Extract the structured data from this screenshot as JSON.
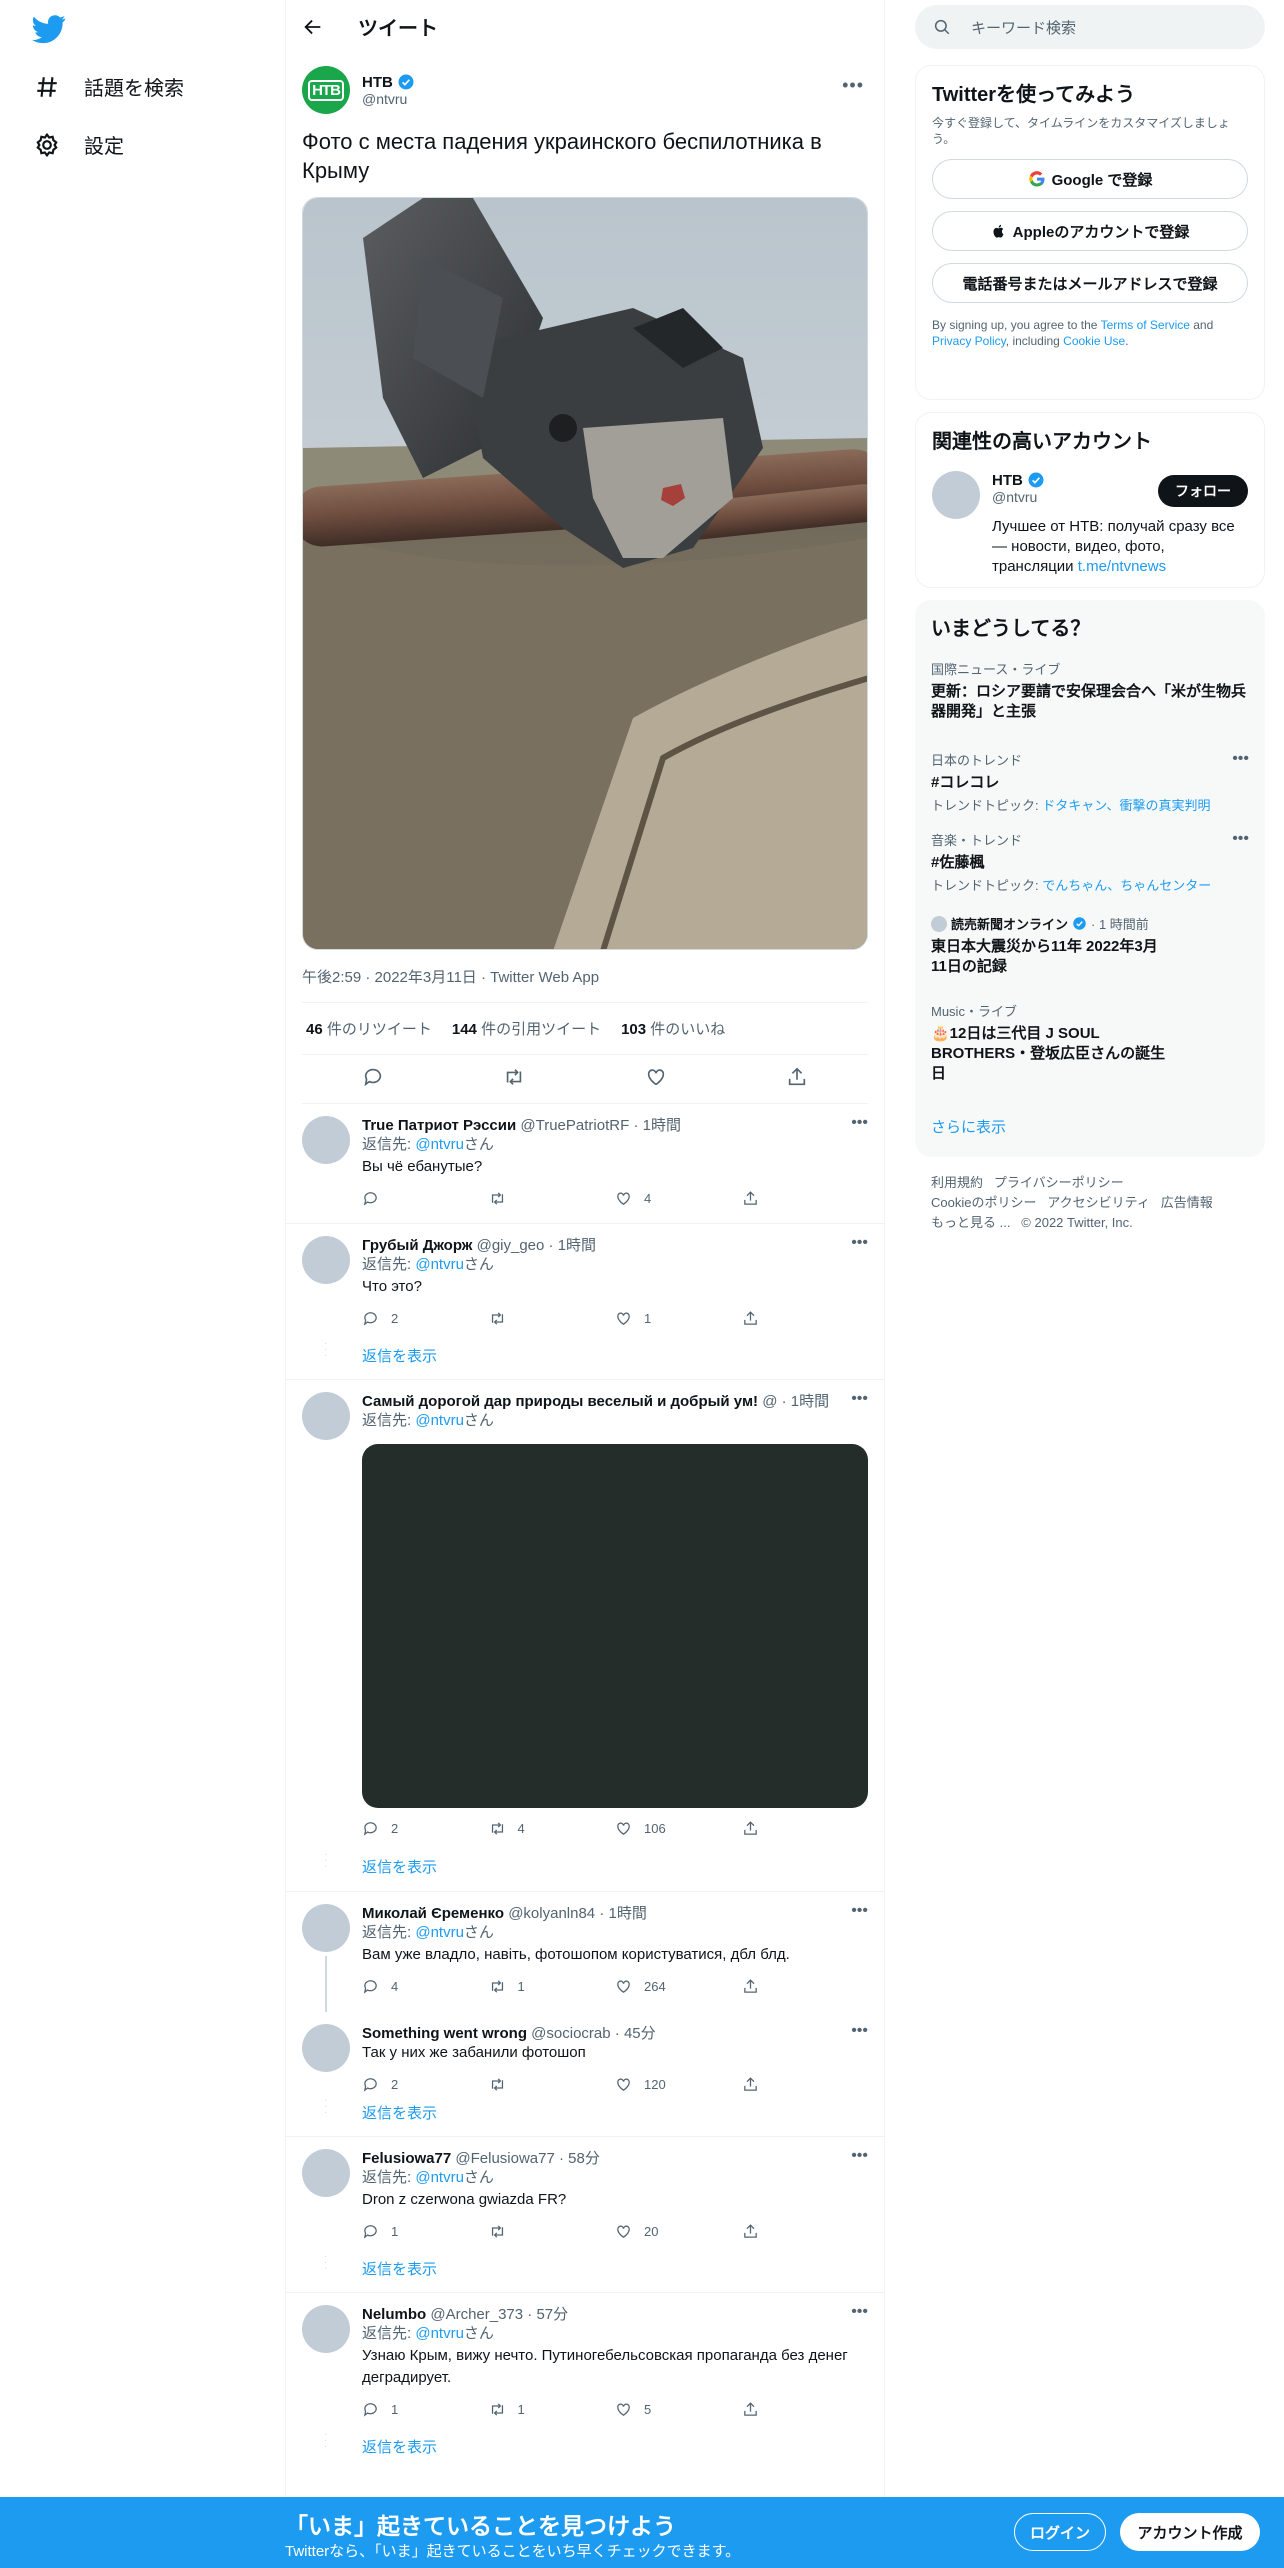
{
  "nav": {
    "explore_label": "話題を検索",
    "settings_label": "設定"
  },
  "header": {
    "title": "ツイート"
  },
  "main_tweet": {
    "name": "НТВ",
    "handle": "@ntvru",
    "avatar_text": "НТВ",
    "text": "Фото с места падения украинского беспилотника в Крыму",
    "meta": "午後2:59 · 2022年3月11日 · Twitter Web App",
    "retweets_count": "46",
    "retweets_label": "件のリツイート",
    "quotes_count": "144",
    "quotes_label": "件の引用ツイート",
    "likes_count": "103",
    "likes_label": "件のいいね"
  },
  "replies": [
    {
      "name": "True Патриот Рэссии",
      "handle": "@TruePatriotRF",
      "time": "· 1時間",
      "reply_to_prefix": "返信先: ",
      "reply_to": "@ntvru",
      "reply_to_suffix": "さん",
      "text": "Вы чё ебанутые?",
      "replies": "",
      "retweets": "",
      "likes": "4"
    },
    {
      "name": "Грубый Джорж",
      "handle": "@giy_geo",
      "time": "· 1時間",
      "reply_to_prefix": "返信先: ",
      "reply_to": "@ntvru",
      "reply_to_suffix": "さん",
      "text": "Что это?",
      "replies": "2",
      "retweets": "",
      "likes": "1",
      "show_replies": "返信を表示"
    },
    {
      "name": "Самый дорогой дар природы веселый и добрый ум!",
      "handle": "@",
      "time": "· 1時間",
      "reply_to_prefix": "返信先: ",
      "reply_to": "@ntvru",
      "reply_to_suffix": "さん",
      "text": "",
      "replies": "2",
      "retweets": "4",
      "likes": "106",
      "show_replies": "返信を表示"
    },
    {
      "name": "Миколай Єременко",
      "handle": "@kolyanln84",
      "time": "· 1時間",
      "reply_to_prefix": "返信先: ",
      "reply_to": "@ntvru",
      "reply_to_suffix": "さん",
      "text": "Вам уже владло, навіть, фотошопом користуватися, дбл блд.",
      "replies": "4",
      "retweets": "1",
      "likes": "264"
    },
    {
      "name": "Something went wrong",
      "handle": "@sociocrab",
      "time": "· 45分",
      "text": "Так у них же забанили фотошоп",
      "replies": "2",
      "retweets": "",
      "likes": "120",
      "show_replies": "返信を表示"
    },
    {
      "name": "Felusiowa77",
      "handle": "@Felusiowa77",
      "time": "· 58分",
      "reply_to_prefix": "返信先: ",
      "reply_to": "@ntvru",
      "reply_to_suffix": "さん",
      "text": "Dron z czerwona gwiazda FR?",
      "replies": "1",
      "retweets": "",
      "likes": "20",
      "show_replies": "返信を表示"
    },
    {
      "name": "Nelumbo",
      "handle": "@Archer_373",
      "time": "· 57分",
      "reply_to_prefix": "返信先: ",
      "reply_to": "@ntvru",
      "reply_to_suffix": "さん",
      "text": "Узнаю Крым, вижу нечто. Путиногебельсовская пропаганда без денег деградирует.",
      "replies": "1",
      "retweets": "1",
      "likes": "5",
      "show_replies": "返信を表示"
    }
  ],
  "search": {
    "placeholder": "キーワード検索"
  },
  "signup_card": {
    "title": "Twitterを使ってみよう",
    "subtitle": "今すぐ登録して、タイムラインをカスタマイズしましょう。",
    "google": "Google で登録",
    "apple": "Appleのアカウントで登録",
    "phone": "電話番号またはメールアドレスで登録",
    "legal_1": "By signing up, you agree to the ",
    "terms": "Terms of Service",
    "legal_2": " and ",
    "privacy": "Privacy Policy",
    "legal_3": ", including ",
    "cookie": "Cookie Use",
    "legal_4": "."
  },
  "related": {
    "title": "関連性の高いアカウント",
    "name": "НТВ",
    "handle": "@ntvru",
    "follow": "フォロー",
    "bio": "Лучшее от НТВ: получай сразу все — новости, видео, фото, трансляции ",
    "bio_link": "t.me/ntvnews"
  },
  "trends": {
    "title": "いまどうしてる？",
    "items": [
      {
        "category": "国際ニュース・ライブ",
        "title": "更新：ロシア要請で安保理会合へ「米が生物兵器開発」と主張"
      },
      {
        "category": "日本のトレンド",
        "title": "#コレコレ",
        "topic_prefix": "トレンドトピック: ",
        "topics": "ドタキャン、衝撃の真実判明"
      },
      {
        "category": "音楽・トレンド",
        "title": "#佐藤楓",
        "topic_prefix": "トレンドトピック: ",
        "topics": "でんちゃん、ちゃんセンター"
      },
      {
        "source": "読売新聞オンライン",
        "time": "· 1 時間前",
        "title": "東日本大震災から11年 2022年3月11日の記録"
      },
      {
        "category": "Music・ライブ",
        "title": "🎂12日は三代目 J SOUL BROTHERS・登坂広臣さんの誕生日"
      }
    ],
    "show_more": "さらに表示"
  },
  "footer": {
    "terms": "利用規約",
    "privacy": "プライバシーポリシー",
    "cookie": "Cookieのポリシー",
    "accessibility": "アクセシビリティ",
    "ads": "広告情報",
    "more": "もっと見る ...",
    "copyright": "© 2022 Twitter, Inc."
  },
  "banner": {
    "title": "「いま」起きていることを見つけよう",
    "subtitle": "Twitterなら、「いま」起きていることをいち早くチェックできます。",
    "login": "ログイン",
    "signup": "アカウント作成"
  },
  "colors": {
    "accent": "#1d9bf0",
    "ntv_green": "#1aa64a",
    "media_dark": "#252d2b"
  }
}
